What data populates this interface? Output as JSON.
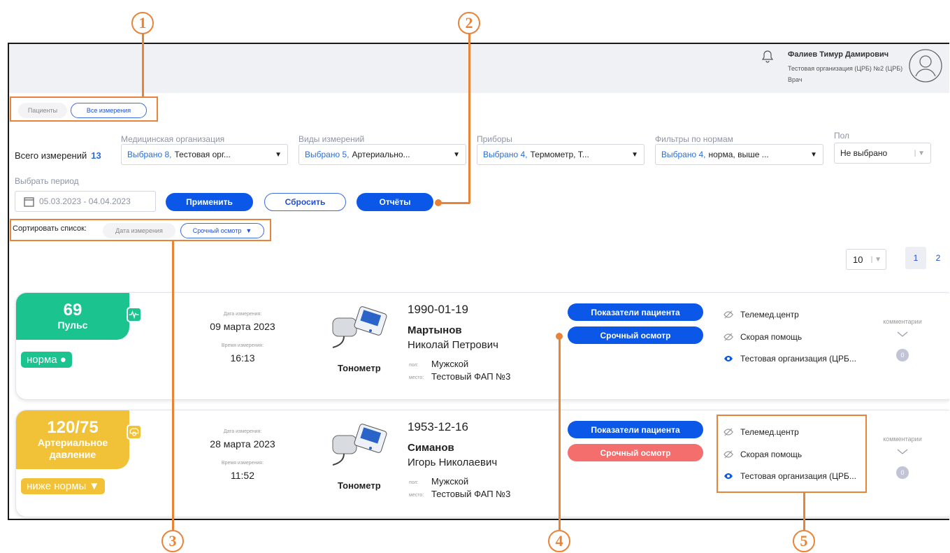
{
  "header": {
    "user_name": "Фалиев Тимур Дамирович",
    "user_org": "Тестовая организация (ЦРБ) №2 (ЦРБ)",
    "user_role": "Врач"
  },
  "tabs": {
    "patients": "Пациенты",
    "all_measurements": "Все измерения"
  },
  "filters": {
    "total_label": "Всего измерений",
    "total_count": "13",
    "med_org": {
      "label": "Медицинская организация",
      "count": "Выбрано 8,",
      "value": "Тестовая орг..."
    },
    "measure_types": {
      "label": "Виды измерений",
      "count": "Выбрано 5,",
      "value": "Артериально..."
    },
    "devices": {
      "label": "Приборы",
      "count": "Выбрано 4,",
      "value": "Термометр, Т..."
    },
    "norm_filters": {
      "label": "Фильтры по нормам",
      "count": "Выбрано 4,",
      "value": "норма, выше ..."
    },
    "sex": {
      "label": "Пол",
      "value": "Не выбрано"
    },
    "period_label": "Выбрать период",
    "period_value": "05.03.2023 - 04.04.2023"
  },
  "buttons": {
    "apply": "Применить",
    "reset": "Сбросить",
    "reports": "Отчёты"
  },
  "sort": {
    "label": "Сортировать список:",
    "by_date": "Дата измерения",
    "by_urgent": "Срочный осмотр"
  },
  "pagination": {
    "page_size": "10",
    "pages": [
      "1",
      "2"
    ],
    "current_page": "1"
  },
  "cards": [
    {
      "value": "69",
      "type_label": "Пульс",
      "status": "норма ●",
      "badge_color": "#1bc48f",
      "date_caption": "Дата измерения:",
      "date": "09 марта 2023",
      "time_caption": "Время измерения:",
      "time": "16:13",
      "device": "Тонометр",
      "birthdate": "1990-01-19",
      "last_name": "Мартынов",
      "first_names": "Николай Петрович",
      "sex_caption": "пол:",
      "sex": "Мужской",
      "place_caption": "место:",
      "place": "Тестовый ФАП №3",
      "btn_indicators": "Показатели пациента",
      "btn_urgent": "Срочный осмотр",
      "urgent_color": "#0a57e8",
      "orgs": [
        "Телемед.центр",
        "Скорая помощь",
        "Тестовая организация (ЦРБ..."
      ],
      "comments_label": "комментарии",
      "comments_count": "0"
    },
    {
      "value": "120/75",
      "type_label_1": "Артериальное",
      "type_label_2": "давление",
      "status": "ниже нормы ▼",
      "badge_color": "#f1c237",
      "date_caption": "Дата измерения:",
      "date": "28 марта 2023",
      "time_caption": "Время измерения:",
      "time": "11:52",
      "device": "Тонометр",
      "birthdate": "1953-12-16",
      "last_name": "Симанов",
      "first_names": "Игорь Николаевич",
      "sex_caption": "пол:",
      "sex": "Мужской",
      "place_caption": "место:",
      "place": "Тестовый ФАП №3",
      "btn_indicators": "Показатели пациента",
      "btn_urgent": "Срочный осмотр",
      "urgent_color": "#f46e6e",
      "orgs": [
        "Телемед.центр",
        "Скорая помощь",
        "Тестовая организация (ЦРБ..."
      ],
      "comments_label": "комментарии",
      "comments_count": "0"
    }
  ],
  "annotations": [
    "1",
    "2",
    "3",
    "4",
    "5"
  ],
  "colors": {
    "accent": "#0a57e8",
    "annotation": "#e8843a",
    "normal": "#1bc48f",
    "low": "#f1c237",
    "urgent": "#f46e6e"
  }
}
